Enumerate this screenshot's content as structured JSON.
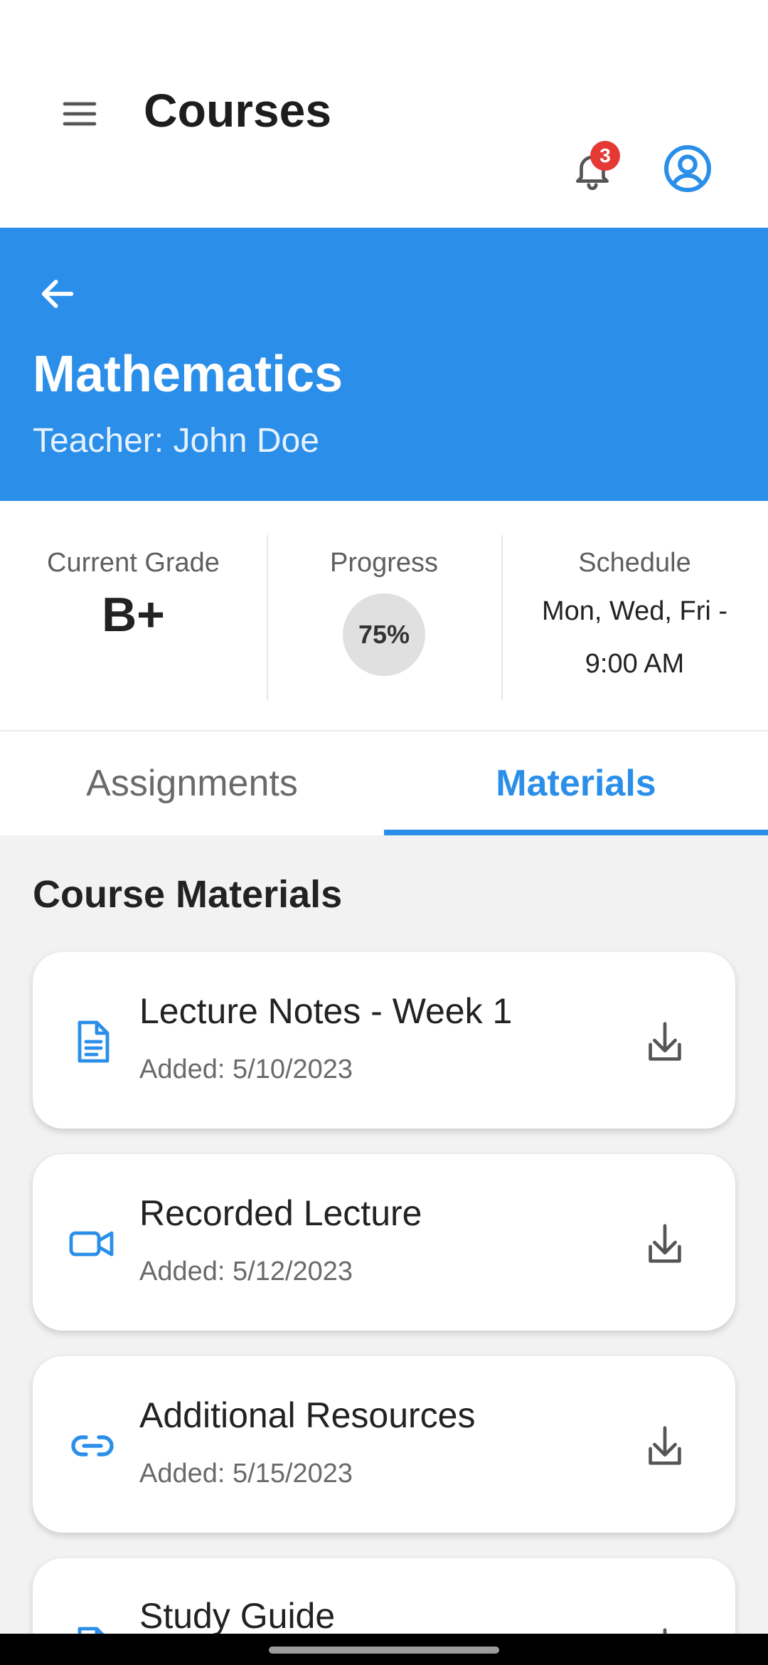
{
  "app_bar": {
    "title": "Courses",
    "notification_count": "3"
  },
  "course": {
    "name": "Mathematics",
    "teacher": "Teacher: John Doe"
  },
  "stats": {
    "grade_label": "Current Grade",
    "grade_value": "B+",
    "progress_label": "Progress",
    "progress_value": "75%",
    "schedule_label": "Schedule",
    "schedule_value": "Mon, Wed, Fri - 9:00 AM"
  },
  "tabs": [
    {
      "label": "Assignments",
      "active": false
    },
    {
      "label": "Materials",
      "active": true
    }
  ],
  "section_title": "Course Materials",
  "materials": [
    {
      "title": "Lecture Notes - Week 1",
      "date": "Added: 5/10/2023",
      "icon": "document-icon"
    },
    {
      "title": "Recorded Lecture",
      "date": "Added: 5/12/2023",
      "icon": "video-icon"
    },
    {
      "title": "Additional Resources",
      "date": "Added: 5/15/2023",
      "icon": "link-icon"
    },
    {
      "title": "Study Guide",
      "date": "",
      "icon": "document-icon"
    }
  ],
  "colors": {
    "accent": "#2b8fea",
    "badge": "#e53935",
    "background": "#f2f2f2"
  }
}
